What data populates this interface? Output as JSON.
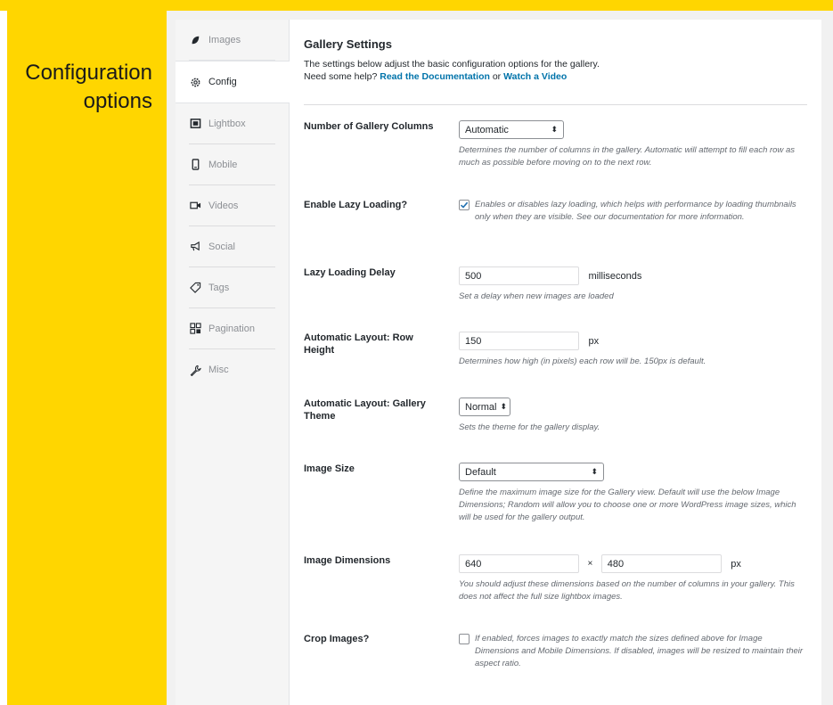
{
  "caption": {
    "line1": "Configuration",
    "line2": "options"
  },
  "tabs": [
    {
      "label": "Images",
      "icon": "leaf-icon",
      "active": false
    },
    {
      "label": "Config",
      "icon": "gear-icon",
      "active": true
    },
    {
      "label": "Lightbox",
      "icon": "lightbox-icon",
      "active": false
    },
    {
      "label": "Mobile",
      "icon": "mobile-icon",
      "active": false
    },
    {
      "label": "Videos",
      "icon": "video-icon",
      "active": false
    },
    {
      "label": "Social",
      "icon": "megaphone-icon",
      "active": false
    },
    {
      "label": "Tags",
      "icon": "tag-icon",
      "active": false
    },
    {
      "label": "Pagination",
      "icon": "pagination-icon",
      "active": false
    },
    {
      "label": "Misc",
      "icon": "wrench-icon",
      "active": false
    }
  ],
  "header": {
    "title": "Gallery Settings",
    "desc_line1": "The settings below adjust the basic configuration options for the gallery.",
    "help_prefix": "Need some help?",
    "doc_link": "Read the Documentation",
    "or": "or",
    "video_link": "Watch a Video"
  },
  "settings": {
    "columns": {
      "label": "Number of Gallery Columns",
      "value": "Automatic",
      "help": "Determines the number of columns in the gallery. Automatic will attempt to fill each row as much as possible before moving on to the next row."
    },
    "lazy": {
      "label": "Enable Lazy Loading?",
      "checked": true,
      "help": "Enables or disables lazy loading, which helps with performance by loading thumbnails only when they are visible. See our documentation for more information."
    },
    "lazy_delay": {
      "label": "Lazy Loading Delay",
      "value": "500",
      "unit": "milliseconds",
      "help": "Set a delay when new images are loaded"
    },
    "row_height": {
      "label": "Automatic Layout: Row Height",
      "value": "150",
      "unit": "px",
      "help": "Determines how high (in pixels) each row will be. 150px is default."
    },
    "theme": {
      "label": "Automatic Layout: Gallery Theme",
      "value": "Normal",
      "help": "Sets the theme for the gallery display."
    },
    "image_size": {
      "label": "Image Size",
      "value": "Default",
      "help": "Define the maximum image size for the Gallery view. Default will use the below Image Dimensions; Random will allow you to choose one or more WordPress image sizes, which will be used for the gallery output."
    },
    "dimensions": {
      "label": "Image Dimensions",
      "width": "640",
      "times": "×",
      "height": "480",
      "unit": "px",
      "help": "You should adjust these dimensions based on the number of columns in your gallery. This does not affect the full size lightbox images."
    },
    "crop": {
      "label": "Crop Images?",
      "checked": false,
      "help": "If enabled, forces images to exactly match the sizes defined above for Image Dimensions and Mobile Dimensions. If disabled, images will be resized to maintain their aspect ratio."
    }
  },
  "colors": {
    "accent_yellow": "#FFD600",
    "link_blue": "#0073aa"
  }
}
